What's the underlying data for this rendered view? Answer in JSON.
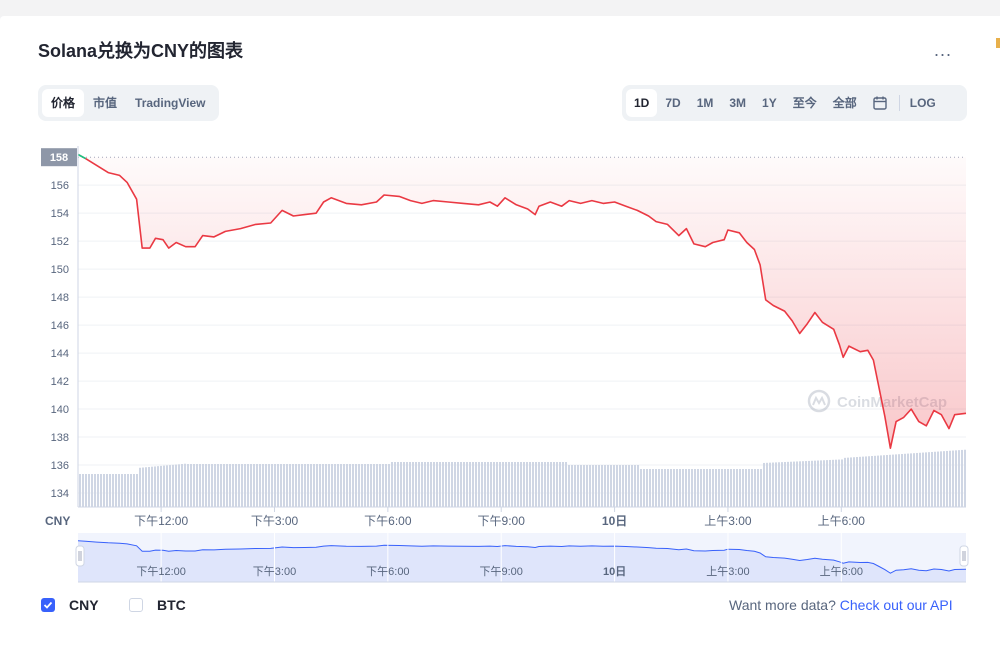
{
  "header": {
    "title": "Solana兑换为CNY的图表",
    "more_label": "..."
  },
  "tabs": [
    {
      "label": "价格",
      "active": true
    },
    {
      "label": "市值",
      "active": false
    },
    {
      "label": "TradingView",
      "active": false
    }
  ],
  "ranges": [
    {
      "label": "1D",
      "active": true
    },
    {
      "label": "7D",
      "active": false
    },
    {
      "label": "1M",
      "active": false
    },
    {
      "label": "3M",
      "active": false
    },
    {
      "label": "1Y",
      "active": false
    },
    {
      "label": "至今",
      "active": false
    },
    {
      "label": "全部",
      "active": false
    }
  ],
  "log_label": "LOG",
  "colors": {
    "line": "#ea3943",
    "line_start": "#16c784",
    "accent": "#3861fb",
    "volume": "#cfd6e4",
    "navigator_fill": "#dfe5fb",
    "navigator_line": "#3861fb"
  },
  "chart_data": {
    "type": "line",
    "currency_label": "CNY",
    "y_ticks": [
      158,
      156,
      154,
      152,
      150,
      148,
      146,
      144,
      142,
      140,
      138,
      136,
      134
    ],
    "ylim": [
      133,
      158.8
    ],
    "current_price_label": "158",
    "reference_price": 158,
    "x_ticks": [
      "下午12:00",
      "下午3:00",
      "下午6:00",
      "下午9:00",
      "10日",
      "上午3:00",
      "上午6:00"
    ],
    "x_ticks_bold": [
      "10日"
    ],
    "x_tick_hours": [
      12,
      15,
      18,
      21,
      24,
      27,
      30
    ],
    "x_range_hours": [
      9.8,
      33.3
    ],
    "watermark": "CoinMarketCap",
    "series": [
      {
        "values": [
          [
            9.8,
            158.2
          ],
          [
            10.0,
            157.9
          ],
          [
            10.3,
            157.4
          ],
          [
            10.6,
            156.9
          ],
          [
            10.9,
            156.7
          ],
          [
            11.1,
            156.2
          ],
          [
            11.35,
            155.0
          ],
          [
            11.5,
            151.5
          ],
          [
            11.7,
            151.5
          ],
          [
            11.85,
            152.2
          ],
          [
            12.05,
            152.1
          ],
          [
            12.2,
            151.5
          ],
          [
            12.4,
            151.9
          ],
          [
            12.65,
            151.6
          ],
          [
            12.9,
            151.6
          ],
          [
            13.1,
            152.4
          ],
          [
            13.4,
            152.3
          ],
          [
            13.7,
            152.7
          ],
          [
            14.1,
            152.9
          ],
          [
            14.5,
            153.2
          ],
          [
            14.9,
            153.3
          ],
          [
            15.2,
            154.2
          ],
          [
            15.5,
            153.8
          ],
          [
            15.8,
            153.9
          ],
          [
            16.1,
            154.0
          ],
          [
            16.3,
            154.8
          ],
          [
            16.5,
            155.1
          ],
          [
            16.9,
            154.7
          ],
          [
            17.3,
            154.6
          ],
          [
            17.7,
            154.8
          ],
          [
            17.9,
            155.3
          ],
          [
            18.3,
            155.2
          ],
          [
            18.6,
            154.9
          ],
          [
            18.9,
            154.7
          ],
          [
            19.2,
            154.9
          ],
          [
            19.6,
            154.8
          ],
          [
            20.0,
            154.7
          ],
          [
            20.4,
            154.6
          ],
          [
            20.7,
            154.8
          ],
          [
            20.9,
            154.5
          ],
          [
            21.1,
            155.1
          ],
          [
            21.4,
            154.6
          ],
          [
            21.7,
            154.3
          ],
          [
            21.9,
            153.9
          ],
          [
            22.0,
            154.5
          ],
          [
            22.3,
            154.8
          ],
          [
            22.6,
            154.5
          ],
          [
            22.8,
            154.9
          ],
          [
            23.1,
            154.7
          ],
          [
            23.4,
            154.9
          ],
          [
            23.7,
            154.7
          ],
          [
            24.0,
            154.8
          ],
          [
            24.3,
            154.5
          ],
          [
            24.6,
            154.2
          ],
          [
            24.9,
            153.8
          ],
          [
            25.1,
            153.4
          ],
          [
            25.4,
            153.2
          ],
          [
            25.7,
            152.4
          ],
          [
            25.9,
            152.9
          ],
          [
            26.1,
            151.8
          ],
          [
            26.4,
            151.6
          ],
          [
            26.6,
            151.9
          ],
          [
            26.9,
            152.1
          ],
          [
            27.0,
            152.8
          ],
          [
            27.3,
            152.6
          ],
          [
            27.5,
            151.9
          ],
          [
            27.7,
            151.4
          ],
          [
            27.85,
            150.3
          ],
          [
            28.0,
            147.8
          ],
          [
            28.2,
            147.4
          ],
          [
            28.5,
            147.0
          ],
          [
            28.7,
            146.3
          ],
          [
            28.9,
            145.4
          ],
          [
            29.1,
            146.1
          ],
          [
            29.3,
            146.9
          ],
          [
            29.5,
            146.2
          ],
          [
            29.8,
            145.7
          ],
          [
            29.95,
            144.6
          ],
          [
            30.05,
            143.7
          ],
          [
            30.2,
            144.5
          ],
          [
            30.5,
            144.1
          ],
          [
            30.7,
            144.2
          ],
          [
            30.85,
            143.5
          ],
          [
            31.0,
            141.5
          ],
          [
            31.15,
            139.5
          ],
          [
            31.3,
            137.2
          ],
          [
            31.45,
            139.1
          ],
          [
            31.65,
            139.4
          ],
          [
            31.85,
            140.0
          ],
          [
            32.05,
            139.1
          ],
          [
            32.25,
            138.8
          ],
          [
            32.45,
            139.9
          ],
          [
            32.65,
            139.6
          ],
          [
            32.85,
            138.6
          ],
          [
            33.0,
            139.6
          ],
          [
            33.3,
            139.7
          ]
        ]
      }
    ],
    "volume_note": "relative volume bars along bottom band",
    "grid": true
  },
  "footer": {
    "legend": [
      {
        "label": "CNY",
        "checked": true
      },
      {
        "label": "BTC",
        "checked": false
      }
    ],
    "api_prompt": "Want more data?",
    "api_link": "Check out our API"
  }
}
